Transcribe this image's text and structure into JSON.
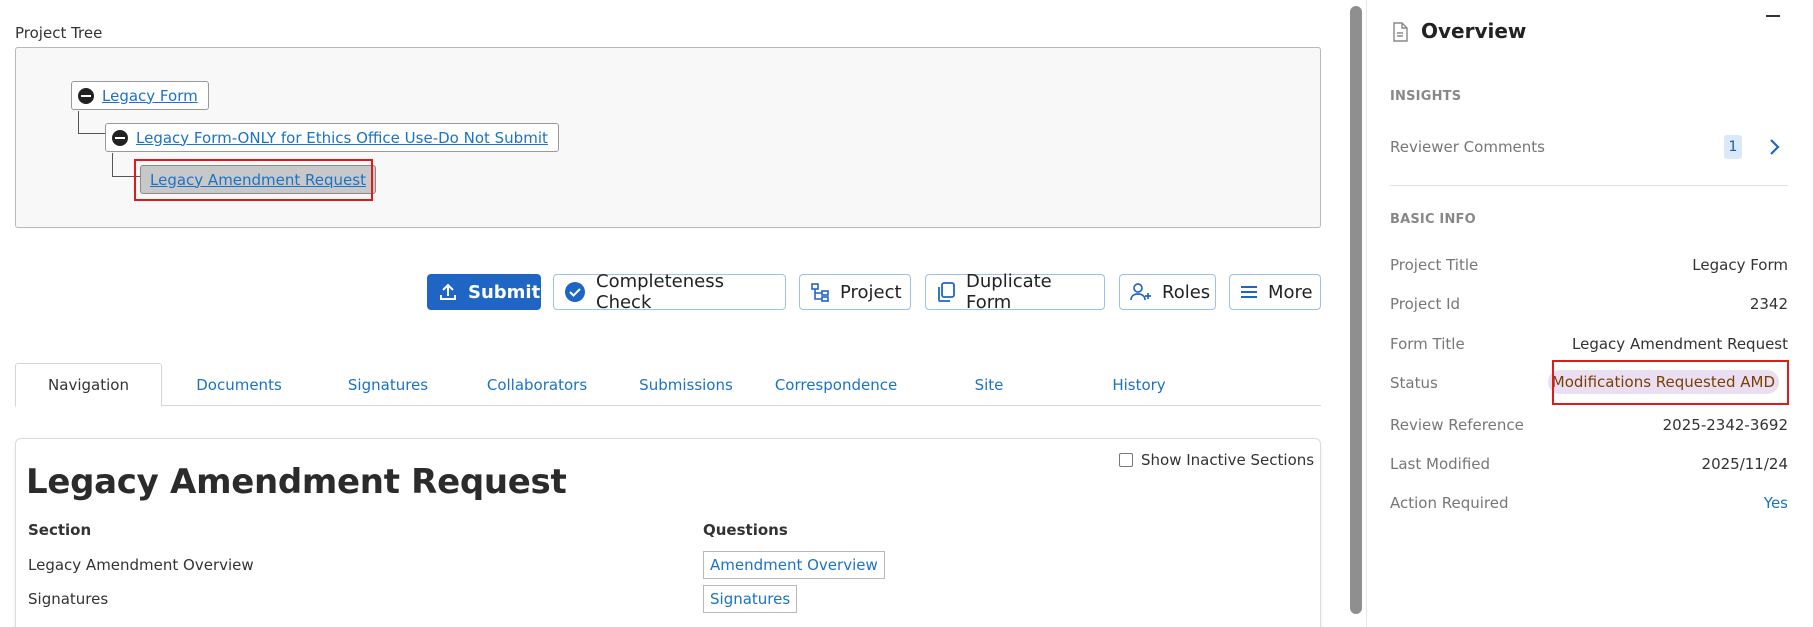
{
  "project_tree": {
    "label": "Project Tree",
    "nodes": [
      {
        "label": "Legacy Form"
      },
      {
        "label": "Legacy Form-ONLY for Ethics Office Use-Do Not Submit"
      },
      {
        "label": "Legacy Amendment Request"
      }
    ]
  },
  "toolbar": {
    "submit": "Submit",
    "completeness": "Completeness Check",
    "project": "Project",
    "duplicate": "Duplicate Form",
    "roles": "Roles",
    "more": "More"
  },
  "tabs": [
    "Navigation",
    "Documents",
    "Signatures",
    "Collaborators",
    "Submissions",
    "Correspondence",
    "Site",
    "History"
  ],
  "form": {
    "title": "Legacy Amendment Request",
    "show_inactive": "Show Inactive Sections",
    "col_section": "Section",
    "col_questions": "Questions",
    "rows": [
      {
        "section": "Legacy Amendment Overview",
        "question": "Amendment Overview"
      },
      {
        "section": "Signatures",
        "question": "Signatures"
      }
    ]
  },
  "overview": {
    "title": "Overview",
    "insights_heading": "INSIGHTS",
    "reviewer_comments_label": "Reviewer Comments",
    "reviewer_comments_count": "1",
    "basic_info_heading": "BASIC INFO",
    "fields": {
      "project_title": {
        "label": "Project Title",
        "value": "Legacy Form"
      },
      "project_id": {
        "label": "Project Id",
        "value": "2342"
      },
      "form_title": {
        "label": "Form Title",
        "value": "Legacy Amendment Request"
      },
      "status": {
        "label": "Status",
        "value": "Modifications Requested AMD"
      },
      "review_reference": {
        "label": "Review Reference",
        "value": "2025-2342-3692"
      },
      "last_modified": {
        "label": "Last Modified",
        "value": "2025/11/24"
      },
      "action_required": {
        "label": "Action Required",
        "value": "Yes"
      }
    }
  },
  "colors": {
    "primary": "#1f66c4",
    "link": "#1a73c8",
    "highlight": "#e0191a",
    "status_bg": "#eadff2"
  }
}
